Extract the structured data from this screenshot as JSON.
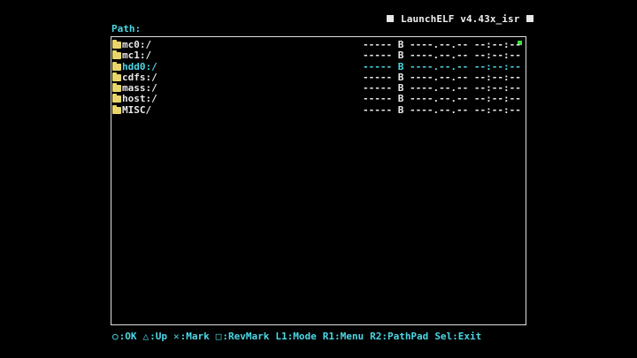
{
  "window": {
    "title": "LaunchELF v4.43x_isr"
  },
  "path": {
    "label": "Path:",
    "value": ""
  },
  "entries": [
    {
      "name": "mc0:/",
      "size": "----- B",
      "date": "----.--.-- --:--:--",
      "selected": false
    },
    {
      "name": "mc1:/",
      "size": "----- B",
      "date": "----.--.-- --:--:--",
      "selected": false
    },
    {
      "name": "hdd0:/",
      "size": "----- B",
      "date": "----.--.-- --:--:--",
      "selected": true
    },
    {
      "name": "cdfs:/",
      "size": "----- B",
      "date": "----.--.-- --:--:--",
      "selected": false
    },
    {
      "name": "mass:/",
      "size": "----- B",
      "date": "----.--.-- --:--:--",
      "selected": false
    },
    {
      "name": "host:/",
      "size": "----- B",
      "date": "----.--.-- --:--:--",
      "selected": false
    },
    {
      "name": "MISC/",
      "size": "----- B",
      "date": "----.--.-- --:--:--",
      "selected": false
    }
  ],
  "footer": {
    "hints": [
      {
        "icon": "circle-button-icon",
        "glyph": "○",
        "text": ":OK"
      },
      {
        "icon": "triangle-button-icon",
        "glyph": "△",
        "text": ":Up"
      },
      {
        "icon": "cross-button-icon",
        "glyph": "✕",
        "text": ":Mark"
      },
      {
        "icon": "square-button-icon",
        "glyph": "□",
        "text": ":RevMark"
      },
      {
        "icon": "",
        "glyph": "",
        "text": "L1:Mode"
      },
      {
        "icon": "",
        "glyph": "",
        "text": "R1:Menu"
      },
      {
        "icon": "",
        "glyph": "",
        "text": "R2:PathPad"
      },
      {
        "icon": "",
        "glyph": "",
        "text": "Sel:Exit"
      }
    ]
  },
  "colors": {
    "accent": "#4ad8e6",
    "folder": "#e8d66a",
    "text": "#e8e8e8",
    "scroll_marker": "#3fe03f",
    "background": "#000000"
  }
}
